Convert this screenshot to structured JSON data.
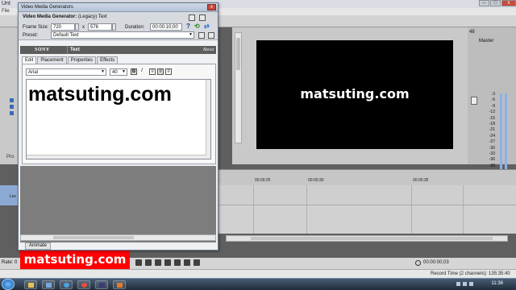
{
  "host": {
    "title": "Unt",
    "menu": "File",
    "tab_project": "Pro",
    "track_label": "Lev",
    "preview_text": "matsuting.com",
    "master": {
      "label": "Master",
      "value": "48"
    },
    "meter_scale": [
      "-3",
      "-6",
      "-9",
      "-12",
      "-15",
      "-18",
      "-21",
      "-24",
      "-27",
      "-30",
      "-33",
      "-36",
      "-39",
      "-42",
      "-45",
      "-48",
      "-51",
      "-54",
      "-57"
    ],
    "meter_bottom": [
      "0.0",
      "0.0"
    ],
    "meter_inf": [
      "-Inf.",
      "-Inf."
    ],
    "ruler_times": [
      "00:00:10",
      "00:00:15",
      "00:00:20",
      "00:00:25",
      "00:00:30",
      "00:00:35"
    ],
    "rate": "Rate: 0",
    "timecode": "00:00:00;03",
    "record_time": "Record Time (2 channels): 135:35:40"
  },
  "watermark": "matsuting.com",
  "taskbar": {
    "clock": "11:36"
  },
  "dialog": {
    "title": "Video Media Generators",
    "close": "x",
    "generator_label": "Video Media Generator:",
    "generator_value": "(Legacy) Text",
    "frame_size_label": "Frame Size:",
    "frame_width": "720",
    "x_label": "x",
    "frame_height": "576",
    "duration_label": "Duration:",
    "duration_value": "00:00:10;00",
    "preset_label": "Preset:",
    "preset_value": "Default Text",
    "plugin_brand": "SONY",
    "plugin_name": "Text",
    "about": "About",
    "tabs": [
      "Edit",
      "Placement",
      "Properties",
      "Effects"
    ],
    "font": "Arial",
    "font_size": "40",
    "bold": "B",
    "italic": "I",
    "content_text": "matsuting.com",
    "animate_tab": "Animate"
  }
}
